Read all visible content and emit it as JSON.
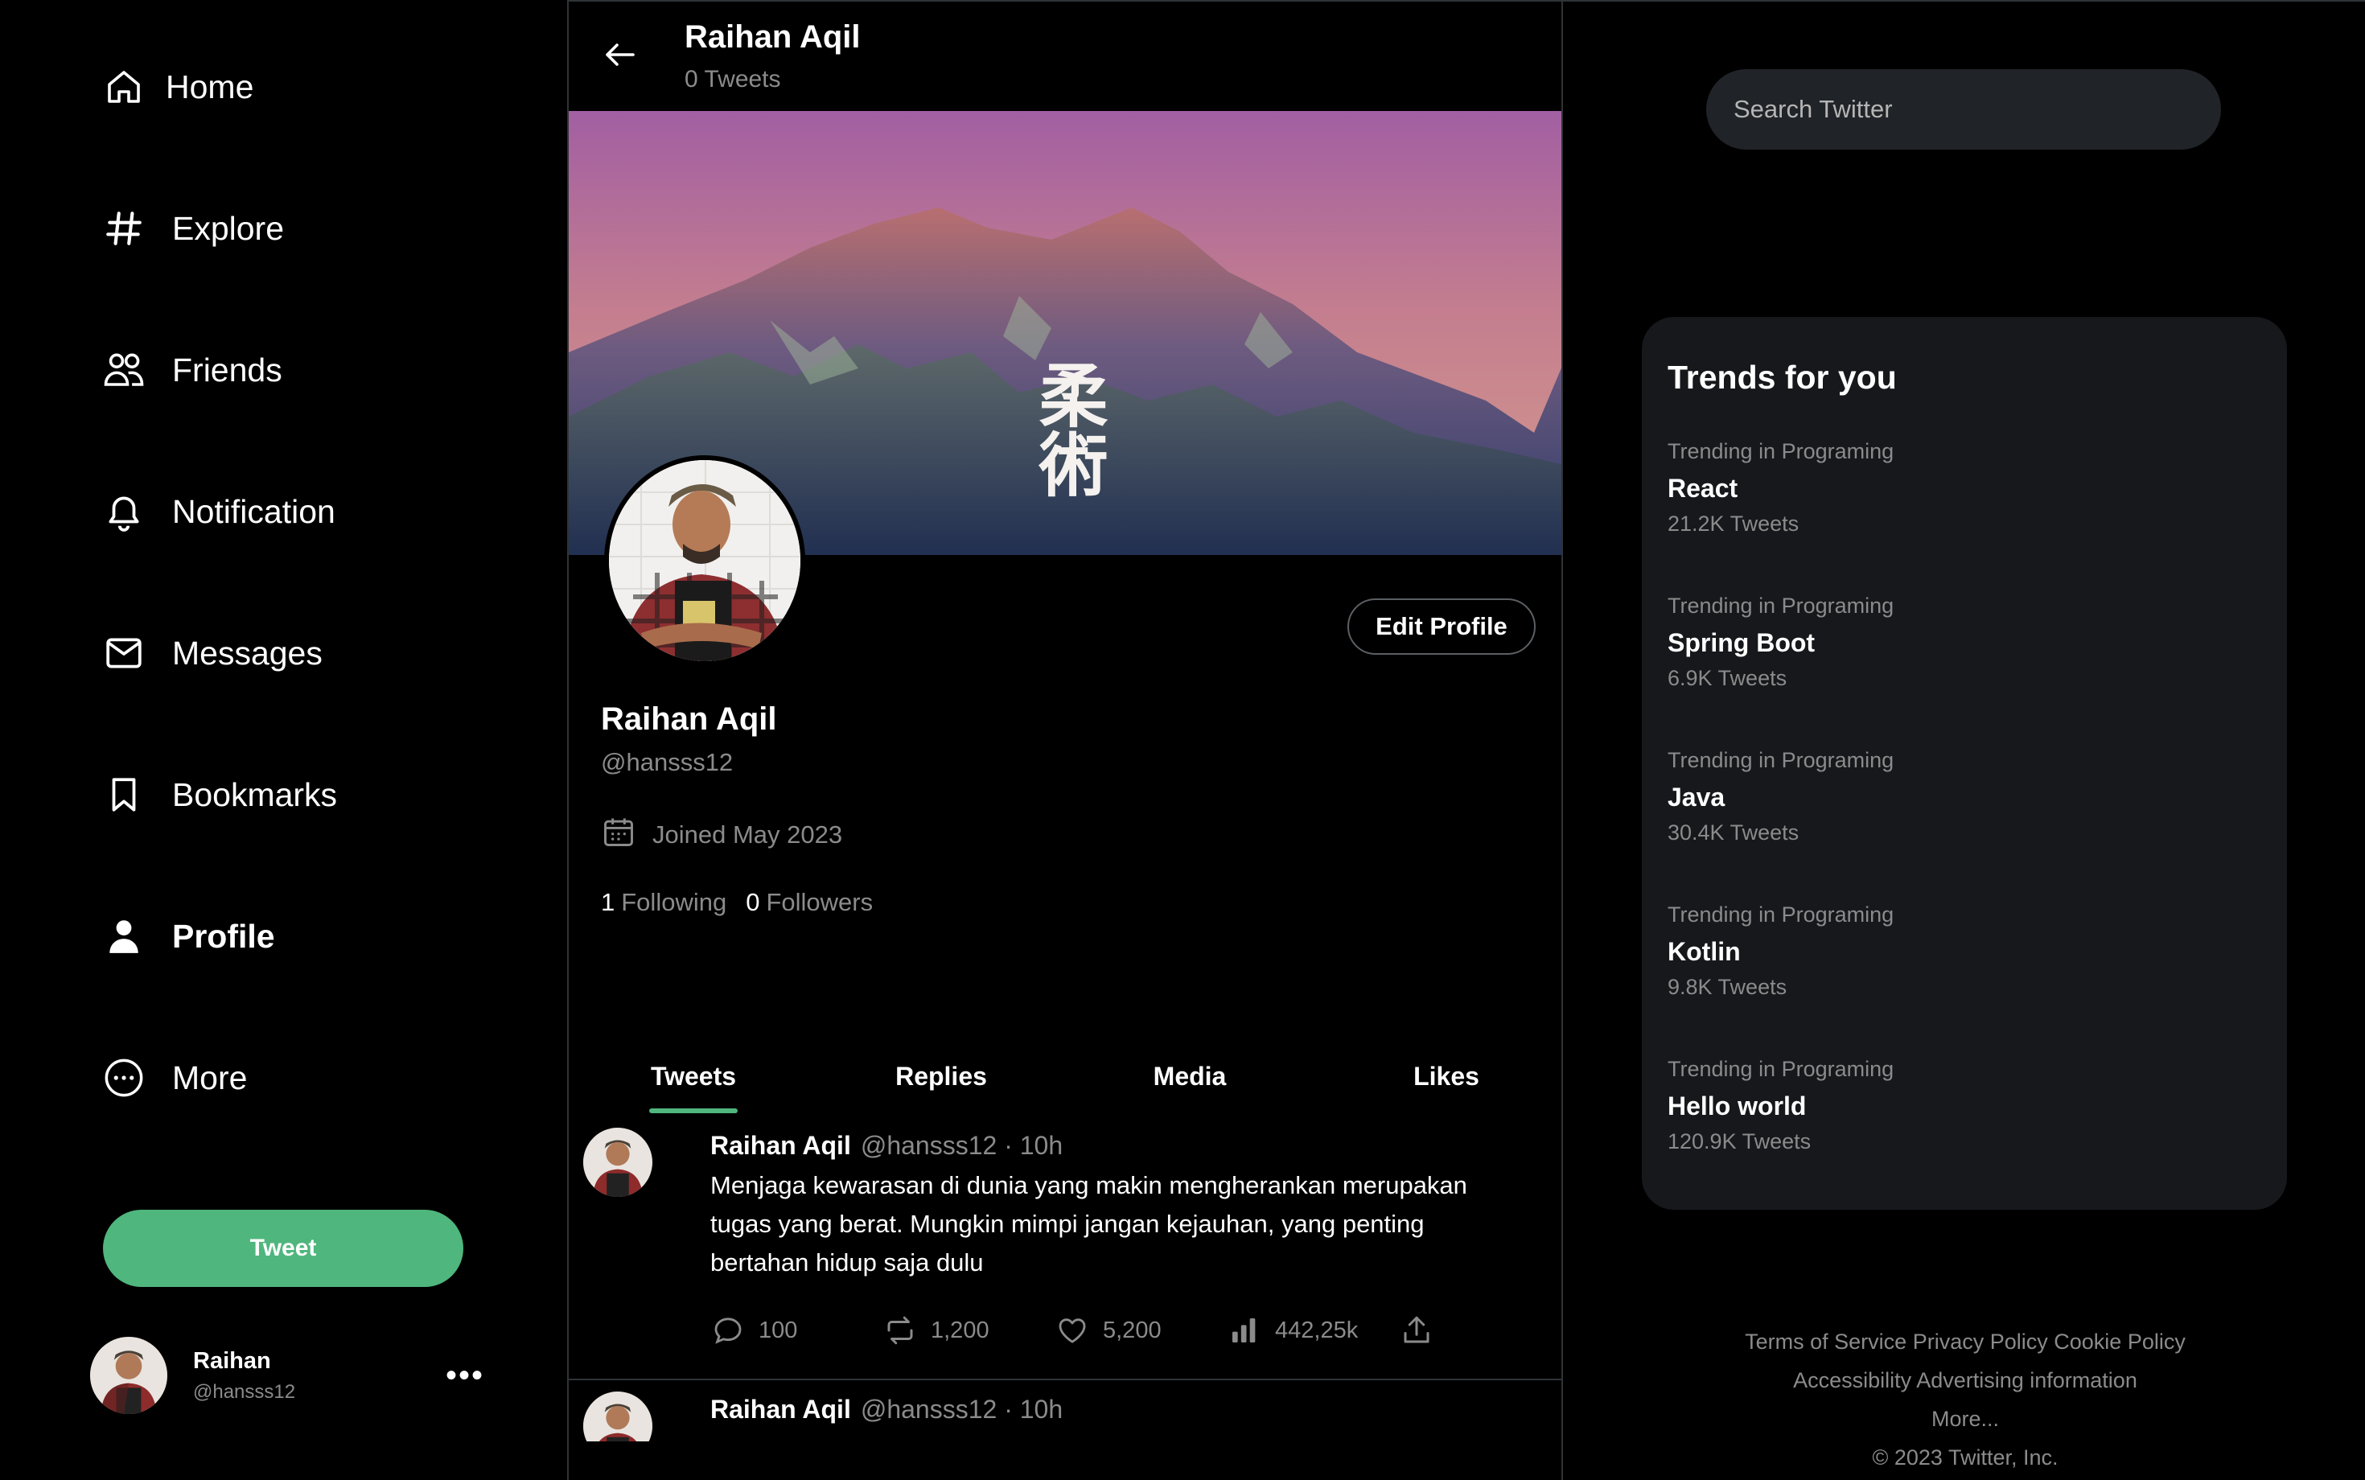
{
  "nav": {
    "items": [
      {
        "label": "Home",
        "icon": "home-icon"
      },
      {
        "label": "Explore",
        "icon": "hashtag-icon"
      },
      {
        "label": "Friends",
        "icon": "friends-icon"
      },
      {
        "label": "Notification",
        "icon": "bell-icon"
      },
      {
        "label": "Messages",
        "icon": "envelope-icon"
      },
      {
        "label": "Bookmarks",
        "icon": "bookmark-icon"
      },
      {
        "label": "Profile",
        "icon": "person-icon"
      },
      {
        "label": "More",
        "icon": "more-circle-icon"
      }
    ],
    "active": "Profile",
    "tweet_button": "Tweet"
  },
  "account": {
    "name": "Raihan",
    "handle": "@hansss12",
    "menu_glyph": "•••"
  },
  "header": {
    "name": "Raihan Aqil",
    "tweet_count": "0 Tweets"
  },
  "profile": {
    "banner_text": "柔術",
    "edit_button": "Edit Profile",
    "name": "Raihan Aqil",
    "handle": "@hansss12",
    "joined": "Joined May 2023",
    "following_count": "1",
    "following_label": "Following",
    "followers_count": "0",
    "followers_label": "Followers"
  },
  "tabs": [
    {
      "label": "Tweets",
      "active": true
    },
    {
      "label": "Replies",
      "active": false
    },
    {
      "label": "Media",
      "active": false
    },
    {
      "label": "Likes",
      "active": false
    }
  ],
  "tweets": [
    {
      "name": "Raihan Aqil",
      "meta": "@hansss12 · 10h",
      "text": "Menjaga kewarasan di dunia yang makin mengherankan merupakan tugas yang berat. Mungkin mimpi jangan kejauhan, yang penting bertahan hidup saja dulu",
      "replies": "100",
      "retweets": "1,200",
      "likes": "5,200",
      "views": "442,25k"
    },
    {
      "name": "Raihan Aqil",
      "meta": "@hansss12 · 10h"
    }
  ],
  "search": {
    "placeholder": "Search Twitter"
  },
  "trends": {
    "title": "Trends for you",
    "items": [
      {
        "category": "Trending in Programing",
        "topic": "React",
        "count": "21.2K Tweets"
      },
      {
        "category": "Trending in Programing",
        "topic": "Spring Boot",
        "count": "6.9K Tweets"
      },
      {
        "category": "Trending in Programing",
        "topic": "Java",
        "count": "30.4K Tweets"
      },
      {
        "category": "Trending in Programing",
        "topic": "Kotlin",
        "count": "9.8K Tweets"
      },
      {
        "category": "Trending in Programing",
        "topic": "Hello world",
        "count": "120.9K Tweets"
      }
    ]
  },
  "footer": {
    "terms": "Terms of Service",
    "privacy": "Privacy Policy",
    "cookie": "Cookie Policy",
    "accessibility": "Accessibility",
    "advertising": "Advertising information",
    "more": "More...",
    "copyright": "© 2023 Twitter, Inc."
  },
  "colors": {
    "accent": "#4fb67d",
    "background": "#000000",
    "panel": "#16181c",
    "muted_text": "#8b8b8b",
    "border": "#2f3336"
  }
}
